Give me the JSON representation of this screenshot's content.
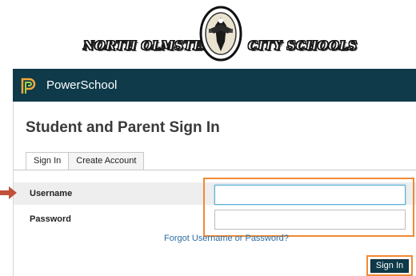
{
  "banner": {
    "left_text": "NORTH OLMSTED",
    "right_text": "CITY SCHOOLS"
  },
  "header": {
    "brand": "PowerSchool",
    "brand_color": "#0e3a4a",
    "logo_icon": "powerschool-p-icon"
  },
  "page": {
    "title": "Student and Parent Sign In"
  },
  "tabs": [
    {
      "label": "Sign In",
      "active": true
    },
    {
      "label": "Create Account",
      "active": false
    }
  ],
  "form": {
    "username_label": "Username",
    "username_value": "",
    "password_label": "Password",
    "password_value": "",
    "forgot_link": "Forgot Username or Password?",
    "submit_label": "Sign In"
  },
  "annotations": {
    "highlight_color": "#f08a34",
    "arrow_color": "#c0503a"
  }
}
